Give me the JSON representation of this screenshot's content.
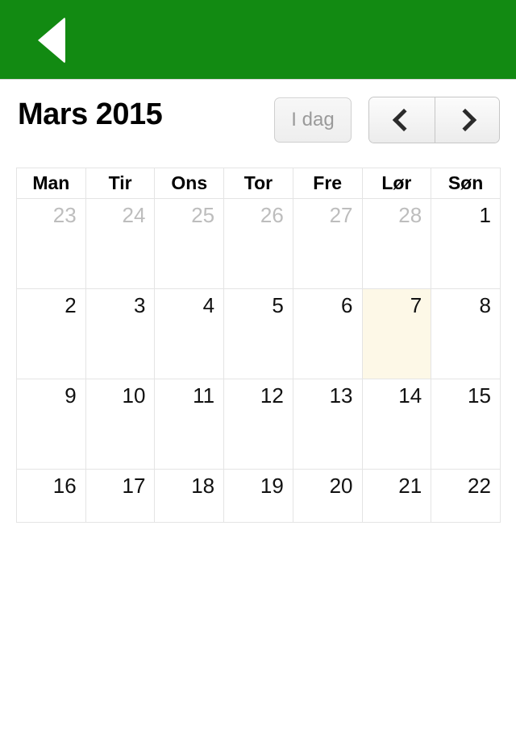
{
  "navbar": {
    "back_icon": "back-triangle-icon",
    "color": "#128a12"
  },
  "toolbar": {
    "title": "Mars 2015",
    "today_label": "I dag",
    "today_disabled": true,
    "prev_icon": "chevron-left-icon",
    "next_icon": "chevron-right-icon"
  },
  "calendar": {
    "weekday_headers": [
      "Man",
      "Tir",
      "Ons",
      "Tor",
      "Fre",
      "Lør",
      "Søn"
    ],
    "highlight_color": "#fdf8e7",
    "weeks": [
      [
        {
          "day": "23",
          "other_month": true,
          "today": false
        },
        {
          "day": "24",
          "other_month": true,
          "today": false
        },
        {
          "day": "25",
          "other_month": true,
          "today": false
        },
        {
          "day": "26",
          "other_month": true,
          "today": false
        },
        {
          "day": "27",
          "other_month": true,
          "today": false
        },
        {
          "day": "28",
          "other_month": true,
          "today": false
        },
        {
          "day": "1",
          "other_month": false,
          "today": false
        }
      ],
      [
        {
          "day": "2",
          "other_month": false,
          "today": false
        },
        {
          "day": "3",
          "other_month": false,
          "today": false
        },
        {
          "day": "4",
          "other_month": false,
          "today": false
        },
        {
          "day": "5",
          "other_month": false,
          "today": false
        },
        {
          "day": "6",
          "other_month": false,
          "today": false
        },
        {
          "day": "7",
          "other_month": false,
          "today": true
        },
        {
          "day": "8",
          "other_month": false,
          "today": false
        }
      ],
      [
        {
          "day": "9",
          "other_month": false,
          "today": false
        },
        {
          "day": "10",
          "other_month": false,
          "today": false
        },
        {
          "day": "11",
          "other_month": false,
          "today": false
        },
        {
          "day": "12",
          "other_month": false,
          "today": false
        },
        {
          "day": "13",
          "other_month": false,
          "today": false
        },
        {
          "day": "14",
          "other_month": false,
          "today": false
        },
        {
          "day": "15",
          "other_month": false,
          "today": false
        }
      ],
      [
        {
          "day": "16",
          "other_month": false,
          "today": false
        },
        {
          "day": "17",
          "other_month": false,
          "today": false
        },
        {
          "day": "18",
          "other_month": false,
          "today": false
        },
        {
          "day": "19",
          "other_month": false,
          "today": false
        },
        {
          "day": "20",
          "other_month": false,
          "today": false
        },
        {
          "day": "21",
          "other_month": false,
          "today": false
        },
        {
          "day": "22",
          "other_month": false,
          "today": false
        }
      ]
    ]
  }
}
